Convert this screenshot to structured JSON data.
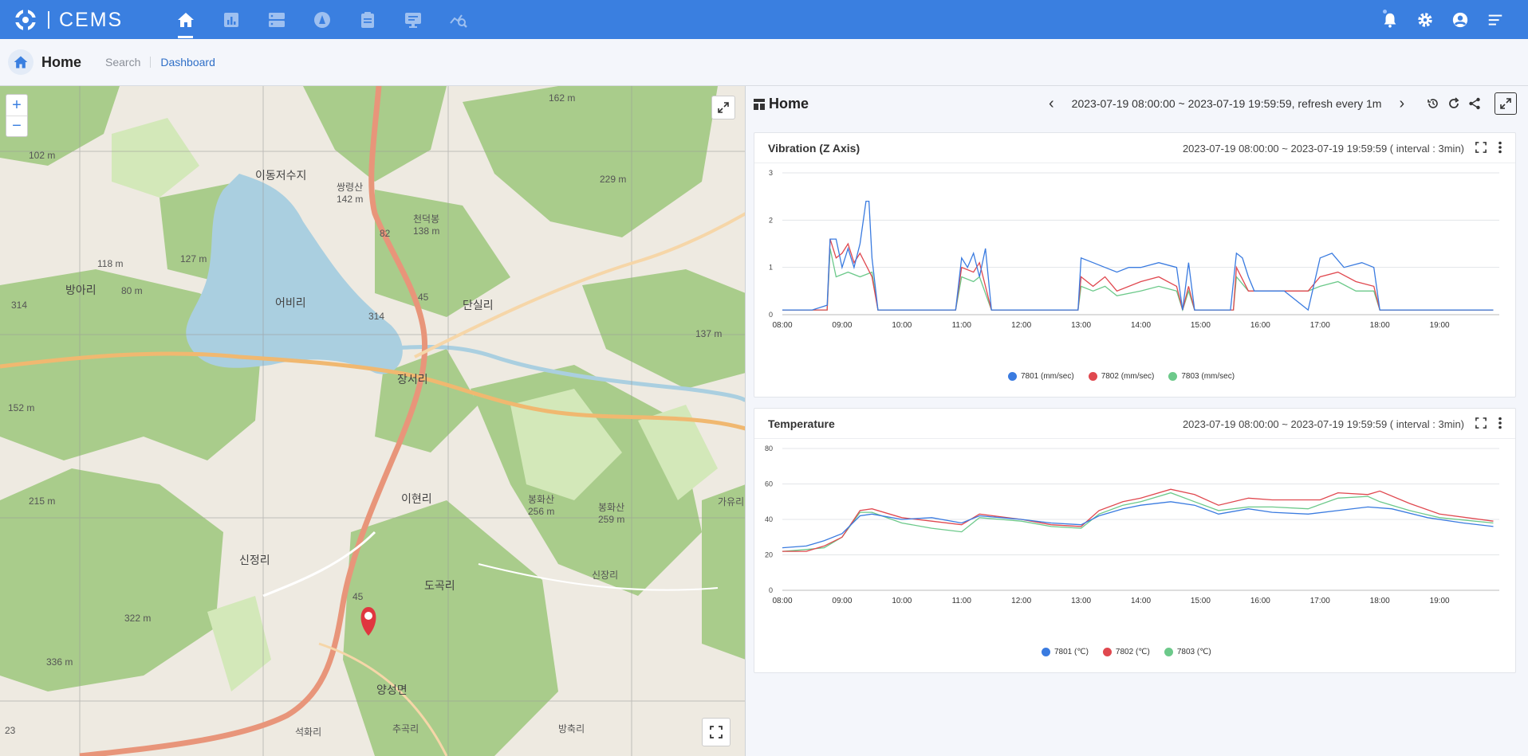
{
  "app": {
    "name": "CEMS"
  },
  "breadcrumb": {
    "title": "Home",
    "links": [
      "Search",
      "Dashboard"
    ]
  },
  "map": {
    "labels": [
      {
        "t": "이동저수지"
      },
      {
        "t": "어비리"
      },
      {
        "t": "방아리"
      },
      {
        "t": "단실리"
      },
      {
        "t": "장서리"
      },
      {
        "t": "이현리"
      },
      {
        "t": "신정리"
      },
      {
        "t": "도곡리"
      },
      {
        "t": "양성면"
      },
      {
        "t": "석화리"
      },
      {
        "t": "추곡리"
      },
      {
        "t": "방축리"
      },
      {
        "t": "신장리"
      },
      {
        "t": "가유리"
      },
      {
        "t": "봉화산\n256 m"
      },
      {
        "t": "봉화산\n259 m"
      },
      {
        "t": "쌍령산\n142 m"
      },
      {
        "t": "천덕봉\n138 m"
      },
      {
        "t": "102 m"
      },
      {
        "t": "118 m"
      },
      {
        "t": "127 m"
      },
      {
        "t": "80 m"
      },
      {
        "t": "152 m"
      },
      {
        "t": "215 m"
      },
      {
        "t": "322 m"
      },
      {
        "t": "336 m"
      },
      {
        "t": "162 m"
      },
      {
        "t": "229 m"
      },
      {
        "t": "137 m"
      },
      {
        "t": "314"
      },
      {
        "t": "314"
      },
      {
        "t": "45"
      },
      {
        "t": "45"
      },
      {
        "t": "82"
      },
      {
        "t": "23"
      }
    ]
  },
  "dashboard": {
    "title": "Home",
    "range_text": "2023-07-19 08:00:00 ~ 2023-07-19 19:59:59",
    "refresh_text": ", refresh every 1m",
    "prev_label": "‹",
    "next_label": "›"
  },
  "colors": {
    "s1": "#3a7be0",
    "s2": "#e0484f",
    "s3": "#6cc98a",
    "topbar": "#3a7fe0"
  },
  "charts": [
    {
      "title": "Vibration (Z Axis)",
      "range": "2023-07-19 08:00:00 ~ 2023-07-19 19:59:59 ( interval : 3min)",
      "legend": [
        "7801 (mm/sec)",
        "7802 (mm/sec)",
        "7803 (mm/sec)"
      ]
    },
    {
      "title": "Temperature",
      "range": "2023-07-19 08:00:00 ~ 2023-07-19 19:59:59 ( interval : 3min)",
      "legend": [
        "7801 (℃)",
        "7802 (℃)",
        "7803 (℃)"
      ]
    }
  ],
  "chart_data": [
    {
      "type": "line",
      "title": "Vibration (Z Axis)",
      "x_ticks": [
        "08:00",
        "09:00",
        "10:00",
        "11:00",
        "12:00",
        "13:00",
        "14:00",
        "15:00",
        "16:00",
        "17:00",
        "18:00",
        "19:00"
      ],
      "y_ticks": [
        "0",
        "1",
        "2",
        "3"
      ],
      "ylim": [
        0,
        3
      ],
      "xlim_hours": [
        8,
        20
      ],
      "series": [
        {
          "name": "7801 (mm/sec)",
          "points": [
            [
              8,
              0.1
            ],
            [
              8.5,
              0.1
            ],
            [
              8.75,
              0.2
            ],
            [
              8.8,
              1.6
            ],
            [
              8.9,
              1.6
            ],
            [
              9.0,
              1.0
            ],
            [
              9.1,
              1.4
            ],
            [
              9.2,
              1.0
            ],
            [
              9.3,
              1.5
            ],
            [
              9.4,
              2.4
            ],
            [
              9.45,
              2.4
            ],
            [
              9.5,
              1.2
            ],
            [
              9.6,
              0.1
            ],
            [
              10.0,
              0.1
            ],
            [
              10.5,
              0.1
            ],
            [
              10.9,
              0.1
            ],
            [
              11.0,
              1.2
            ],
            [
              11.1,
              1.0
            ],
            [
              11.2,
              1.3
            ],
            [
              11.3,
              0.8
            ],
            [
              11.4,
              1.4
            ],
            [
              11.5,
              0.1
            ],
            [
              12.0,
              0.1
            ],
            [
              12.5,
              0.1
            ],
            [
              12.95,
              0.1
            ],
            [
              13.0,
              1.2
            ],
            [
              13.2,
              1.1
            ],
            [
              13.4,
              1.0
            ],
            [
              13.6,
              0.9
            ],
            [
              13.8,
              1.0
            ],
            [
              14.0,
              1.0
            ],
            [
              14.3,
              1.1
            ],
            [
              14.6,
              1.0
            ],
            [
              14.7,
              0.1
            ],
            [
              14.8,
              1.1
            ],
            [
              14.9,
              0.1
            ],
            [
              15.5,
              0.1
            ],
            [
              15.6,
              1.3
            ],
            [
              15.7,
              1.2
            ],
            [
              15.8,
              0.8
            ],
            [
              15.9,
              0.5
            ],
            [
              16.4,
              0.5
            ],
            [
              16.8,
              0.1
            ],
            [
              17.0,
              1.2
            ],
            [
              17.2,
              1.3
            ],
            [
              17.4,
              1.0
            ],
            [
              17.7,
              1.1
            ],
            [
              17.9,
              1.0
            ],
            [
              18.0,
              0.1
            ],
            [
              18.5,
              0.1
            ],
            [
              19.0,
              0.1
            ],
            [
              19.5,
              0.1
            ],
            [
              19.9,
              0.1
            ]
          ]
        },
        {
          "name": "7802 (mm/sec)",
          "points": [
            [
              8,
              0.1
            ],
            [
              8.75,
              0.1
            ],
            [
              8.8,
              1.6
            ],
            [
              8.9,
              1.2
            ],
            [
              9.0,
              1.3
            ],
            [
              9.1,
              1.5
            ],
            [
              9.2,
              1.1
            ],
            [
              9.3,
              1.3
            ],
            [
              9.5,
              0.8
            ],
            [
              9.6,
              0.1
            ],
            [
              10.9,
              0.1
            ],
            [
              11.0,
              1.0
            ],
            [
              11.2,
              0.9
            ],
            [
              11.3,
              1.1
            ],
            [
              11.5,
              0.1
            ],
            [
              12.95,
              0.1
            ],
            [
              13.0,
              0.8
            ],
            [
              13.2,
              0.6
            ],
            [
              13.4,
              0.8
            ],
            [
              13.6,
              0.5
            ],
            [
              14.0,
              0.7
            ],
            [
              14.3,
              0.8
            ],
            [
              14.6,
              0.6
            ],
            [
              14.7,
              0.1
            ],
            [
              14.8,
              0.6
            ],
            [
              14.9,
              0.1
            ],
            [
              15.55,
              0.1
            ],
            [
              15.6,
              1.0
            ],
            [
              15.8,
              0.5
            ],
            [
              16.4,
              0.5
            ],
            [
              16.8,
              0.5
            ],
            [
              17.0,
              0.8
            ],
            [
              17.3,
              0.9
            ],
            [
              17.6,
              0.7
            ],
            [
              17.9,
              0.6
            ],
            [
              18.0,
              0.1
            ],
            [
              19.9,
              0.1
            ]
          ]
        },
        {
          "name": "7803 (mm/sec)",
          "points": [
            [
              8,
              0.1
            ],
            [
              8.75,
              0.1
            ],
            [
              8.8,
              1.4
            ],
            [
              8.9,
              0.8
            ],
            [
              9.1,
              0.9
            ],
            [
              9.3,
              0.8
            ],
            [
              9.5,
              0.9
            ],
            [
              9.6,
              0.1
            ],
            [
              10.9,
              0.1
            ],
            [
              11.0,
              0.8
            ],
            [
              11.2,
              0.7
            ],
            [
              11.3,
              0.8
            ],
            [
              11.5,
              0.1
            ],
            [
              12.95,
              0.1
            ],
            [
              13.0,
              0.6
            ],
            [
              13.2,
              0.5
            ],
            [
              13.4,
              0.6
            ],
            [
              13.6,
              0.4
            ],
            [
              14.0,
              0.5
            ],
            [
              14.3,
              0.6
            ],
            [
              14.6,
              0.5
            ],
            [
              14.7,
              0.1
            ],
            [
              14.8,
              0.5
            ],
            [
              14.9,
              0.1
            ],
            [
              15.55,
              0.1
            ],
            [
              15.6,
              0.8
            ],
            [
              15.8,
              0.5
            ],
            [
              16.8,
              0.5
            ],
            [
              17.0,
              0.6
            ],
            [
              17.3,
              0.7
            ],
            [
              17.6,
              0.5
            ],
            [
              17.9,
              0.5
            ],
            [
              18.0,
              0.1
            ],
            [
              19.9,
              0.1
            ]
          ]
        }
      ]
    },
    {
      "type": "line",
      "title": "Temperature",
      "x_ticks": [
        "08:00",
        "09:00",
        "10:00",
        "11:00",
        "12:00",
        "13:00",
        "14:00",
        "15:00",
        "16:00",
        "17:00",
        "18:00",
        "19:00"
      ],
      "y_ticks": [
        "0",
        "20",
        "40",
        "60",
        "80"
      ],
      "ylim": [
        0,
        80
      ],
      "xlim_hours": [
        8,
        20
      ],
      "series": [
        {
          "name": "7801 (℃)",
          "points": [
            [
              8,
              24
            ],
            [
              8.4,
              25
            ],
            [
              8.7,
              28
            ],
            [
              9.0,
              32
            ],
            [
              9.3,
              42
            ],
            [
              9.5,
              43
            ],
            [
              10.0,
              40
            ],
            [
              10.5,
              41
            ],
            [
              11.0,
              38
            ],
            [
              11.3,
              42
            ],
            [
              12.0,
              40
            ],
            [
              12.5,
              38
            ],
            [
              13.0,
              37
            ],
            [
              13.3,
              42
            ],
            [
              13.7,
              46
            ],
            [
              14.0,
              48
            ],
            [
              14.5,
              50
            ],
            [
              14.9,
              48
            ],
            [
              15.3,
              43
            ],
            [
              15.8,
              46
            ],
            [
              16.2,
              44
            ],
            [
              16.8,
              43
            ],
            [
              17.3,
              45
            ],
            [
              17.8,
              47
            ],
            [
              18.2,
              46
            ],
            [
              18.8,
              41
            ],
            [
              19.4,
              38
            ],
            [
              19.9,
              36
            ]
          ]
        },
        {
          "name": "7802 (℃)",
          "points": [
            [
              8,
              22
            ],
            [
              8.4,
              22
            ],
            [
              8.7,
              25
            ],
            [
              9.0,
              30
            ],
            [
              9.3,
              45
            ],
            [
              9.5,
              46
            ],
            [
              10.0,
              41
            ],
            [
              10.5,
              39
            ],
            [
              11.0,
              37
            ],
            [
              11.3,
              43
            ],
            [
              12.0,
              40
            ],
            [
              12.5,
              37
            ],
            [
              13.0,
              36
            ],
            [
              13.3,
              45
            ],
            [
              13.7,
              50
            ],
            [
              14.0,
              52
            ],
            [
              14.5,
              57
            ],
            [
              14.9,
              54
            ],
            [
              15.3,
              48
            ],
            [
              15.8,
              52
            ],
            [
              16.2,
              51
            ],
            [
              16.8,
              51
            ],
            [
              17.0,
              51
            ],
            [
              17.3,
              55
            ],
            [
              17.8,
              54
            ],
            [
              18.0,
              56
            ],
            [
              18.5,
              49
            ],
            [
              19.0,
              43
            ],
            [
              19.9,
              39
            ]
          ]
        },
        {
          "name": "7803 (℃)",
          "points": [
            [
              8,
              22
            ],
            [
              8.4,
              23
            ],
            [
              8.7,
              24
            ],
            [
              9.0,
              30
            ],
            [
              9.3,
              44
            ],
            [
              9.5,
              44
            ],
            [
              10.0,
              38
            ],
            [
              10.5,
              35
            ],
            [
              11.0,
              33
            ],
            [
              11.3,
              41
            ],
            [
              12.0,
              39
            ],
            [
              12.5,
              36
            ],
            [
              13.0,
              35
            ],
            [
              13.3,
              43
            ],
            [
              13.7,
              48
            ],
            [
              14.0,
              50
            ],
            [
              14.5,
              55
            ],
            [
              14.9,
              50
            ],
            [
              15.3,
              45
            ],
            [
              15.8,
              47
            ],
            [
              16.2,
              47
            ],
            [
              16.8,
              46
            ],
            [
              17.3,
              52
            ],
            [
              17.8,
              53
            ],
            [
              18.0,
              50
            ],
            [
              18.5,
              45
            ],
            [
              19.0,
              41
            ],
            [
              19.9,
              38
            ]
          ]
        }
      ]
    }
  ]
}
